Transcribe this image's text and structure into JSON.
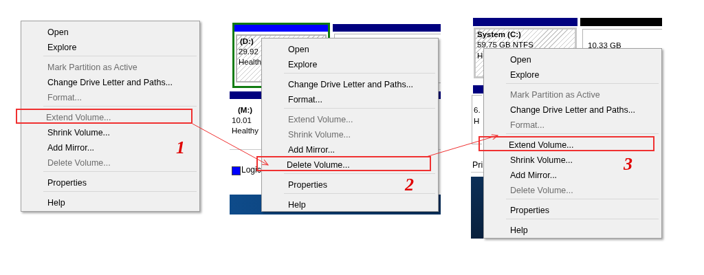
{
  "panels": [
    {
      "step": "1",
      "menu": [
        {
          "kind": "item",
          "label": "Open",
          "disabled": false,
          "highlighted": false
        },
        {
          "kind": "item",
          "label": "Explore",
          "disabled": false,
          "highlighted": false
        },
        {
          "kind": "separator"
        },
        {
          "kind": "item",
          "label": "Mark Partition as Active",
          "disabled": true,
          "highlighted": false
        },
        {
          "kind": "item",
          "label": "Change Drive Letter and Paths...",
          "disabled": false,
          "highlighted": false
        },
        {
          "kind": "item",
          "label": "Format...",
          "disabled": true,
          "highlighted": false
        },
        {
          "kind": "separator"
        },
        {
          "kind": "item",
          "label": "Extend Volume...",
          "disabled": true,
          "highlighted": true
        },
        {
          "kind": "item",
          "label": "Shrink Volume...",
          "disabled": false,
          "highlighted": false
        },
        {
          "kind": "item",
          "label": "Add Mirror...",
          "disabled": false,
          "highlighted": false
        },
        {
          "kind": "item",
          "label": "Delete Volume...",
          "disabled": true,
          "highlighted": false
        },
        {
          "kind": "separator"
        },
        {
          "kind": "item",
          "label": "Properties",
          "disabled": false,
          "highlighted": false
        },
        {
          "kind": "separator"
        },
        {
          "kind": "item",
          "label": "Help",
          "disabled": false,
          "highlighted": false
        }
      ]
    },
    {
      "step": "2",
      "background": {
        "kind": "disks-d",
        "texts": [
          "(D:)",
          "29.92",
          "Health",
          "(M:)",
          "10.01",
          "Healthy",
          "Logic"
        ]
      },
      "menu": [
        {
          "kind": "item",
          "label": "Open",
          "disabled": false,
          "highlighted": false
        },
        {
          "kind": "item",
          "label": "Explore",
          "disabled": false,
          "highlighted": false
        },
        {
          "kind": "separator"
        },
        {
          "kind": "item",
          "label": "Change Drive Letter and Paths...",
          "disabled": false,
          "highlighted": false
        },
        {
          "kind": "item",
          "label": "Format...",
          "disabled": false,
          "highlighted": false
        },
        {
          "kind": "separator"
        },
        {
          "kind": "item",
          "label": "Extend Volume...",
          "disabled": true,
          "highlighted": false
        },
        {
          "kind": "item",
          "label": "Shrink Volume...",
          "disabled": true,
          "highlighted": false
        },
        {
          "kind": "item",
          "label": "Add Mirror...",
          "disabled": false,
          "highlighted": false
        },
        {
          "kind": "item",
          "label": "Delete Volume...",
          "disabled": false,
          "highlighted": true
        },
        {
          "kind": "separator"
        },
        {
          "kind": "item",
          "label": "Properties",
          "disabled": false,
          "highlighted": false
        },
        {
          "kind": "separator"
        },
        {
          "kind": "item",
          "label": "Help",
          "disabled": false,
          "highlighted": false
        }
      ]
    },
    {
      "step": "3",
      "background": {
        "kind": "disks-c",
        "texts": [
          "System  (C:)",
          "59.75 GB NTFS",
          "H",
          "10.33 GB",
          "6.",
          "H",
          "Pri"
        ]
      },
      "menu": [
        {
          "kind": "item",
          "label": "Open",
          "disabled": false,
          "highlighted": false
        },
        {
          "kind": "item",
          "label": "Explore",
          "disabled": false,
          "highlighted": false
        },
        {
          "kind": "separator"
        },
        {
          "kind": "item",
          "label": "Mark Partition as Active",
          "disabled": true,
          "highlighted": false
        },
        {
          "kind": "item",
          "label": "Change Drive Letter and Paths...",
          "disabled": false,
          "highlighted": false
        },
        {
          "kind": "item",
          "label": "Format...",
          "disabled": true,
          "highlighted": false
        },
        {
          "kind": "separator"
        },
        {
          "kind": "item",
          "label": "Extend Volume...",
          "disabled": false,
          "highlighted": true
        },
        {
          "kind": "item",
          "label": "Shrink Volume...",
          "disabled": false,
          "highlighted": false
        },
        {
          "kind": "item",
          "label": "Add Mirror...",
          "disabled": false,
          "highlighted": false
        },
        {
          "kind": "item",
          "label": "Delete Volume...",
          "disabled": true,
          "highlighted": false
        },
        {
          "kind": "separator"
        },
        {
          "kind": "item",
          "label": "Properties",
          "disabled": false,
          "highlighted": false
        },
        {
          "kind": "separator"
        },
        {
          "kind": "item",
          "label": "Help",
          "disabled": false,
          "highlighted": false
        }
      ]
    }
  ]
}
